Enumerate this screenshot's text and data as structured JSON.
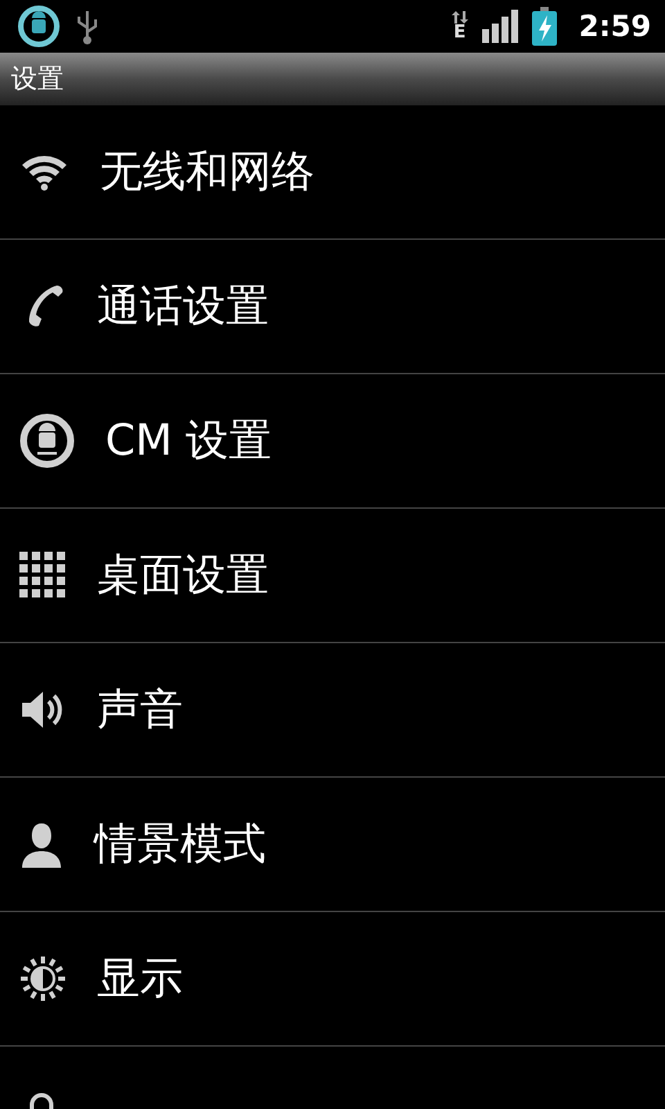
{
  "status_bar": {
    "network": "E",
    "time": "2:59"
  },
  "title": "设置",
  "items": [
    {
      "kind": "wifi",
      "label": "无线和网络"
    },
    {
      "kind": "phone",
      "label": "通话设置"
    },
    {
      "kind": "cm",
      "label": "CM 设置"
    },
    {
      "kind": "grid",
      "label": "桌面设置"
    },
    {
      "kind": "sound",
      "label": "声音"
    },
    {
      "kind": "profile",
      "label": "情景模式"
    },
    {
      "kind": "display",
      "label": "显示"
    },
    {
      "kind": "location"
    }
  ]
}
